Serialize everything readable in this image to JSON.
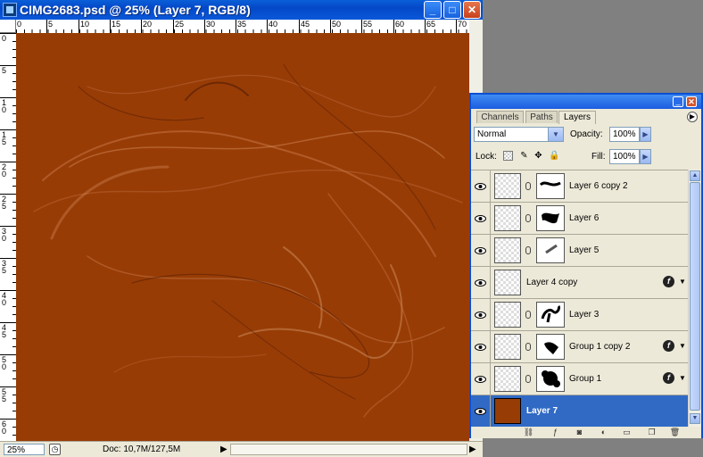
{
  "document": {
    "title": "CIMG2683.psd @ 25% (Layer 7, RGB/8)",
    "canvas_color": "#983c06",
    "ruler_h_labels": [
      "0",
      "5",
      "10",
      "15",
      "20",
      "25",
      "30",
      "35",
      "40",
      "45",
      "50",
      "55",
      "60",
      "65",
      "70"
    ],
    "ruler_v_labels": [
      "0",
      "5",
      "10",
      "15",
      "20",
      "25",
      "30",
      "35",
      "40",
      "45",
      "50",
      "55",
      "60"
    ],
    "status": {
      "zoom": "25%",
      "doc_size": "Doc: 10,7M/127,5M"
    }
  },
  "window_controls": {
    "minimize": "_",
    "maximize": "□",
    "close": "✕"
  },
  "palette": {
    "tabs": [
      "Channels",
      "Paths",
      "Layers"
    ],
    "active_tab": "Layers",
    "blend_mode": "Normal",
    "opacity_label": "Opacity:",
    "opacity": "100%",
    "lock_label": "Lock:",
    "fill_label": "Fill:",
    "fill": "100%",
    "layers": [
      {
        "name": "Layer 6 copy 2",
        "mask": true,
        "fx": false,
        "selected": false
      },
      {
        "name": "Layer 6",
        "mask": true,
        "fx": false,
        "selected": false
      },
      {
        "name": "Layer 5",
        "mask": true,
        "fx": false,
        "selected": false
      },
      {
        "name": "Layer 4 copy",
        "mask": false,
        "fx": true,
        "selected": false
      },
      {
        "name": "Layer 3",
        "mask": true,
        "fx": false,
        "selected": false
      },
      {
        "name": "Group 1 copy 2",
        "mask": true,
        "fx": true,
        "selected": false
      },
      {
        "name": "Group 1",
        "mask": true,
        "fx": true,
        "selected": false
      },
      {
        "name": "Layer 7",
        "mask": false,
        "fx": false,
        "selected": true
      }
    ]
  }
}
